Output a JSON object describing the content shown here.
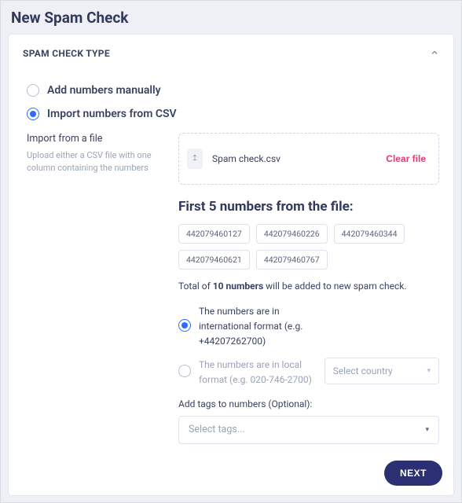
{
  "page": {
    "title": "New Spam Check"
  },
  "section": {
    "title": "SPAM CHECK TYPE"
  },
  "inputMethod": {
    "manual": "Add numbers manually",
    "csv": "Import numbers from CSV"
  },
  "help": {
    "title": "Import from a file",
    "text": "Upload either a CSV file with one column containing the numbers"
  },
  "upload": {
    "fileName": "Spam check.csv",
    "clearLabel": "Clear file"
  },
  "preview": {
    "title": "First 5 numbers from the file:",
    "chips": [
      "442079460127",
      "442079460226",
      "442079460344",
      "442079460621",
      "442079460767"
    ]
  },
  "total": {
    "prefix": "Total of ",
    "count": "10 numbers",
    "suffix": " will be added to new spam check."
  },
  "format": {
    "intl": "The numbers are in international format (e.g. +44207262700)",
    "local": "The numbers are in local format (e.g. 020-746-2700)"
  },
  "country": {
    "placeholder": "Select country"
  },
  "tags": {
    "label": "Add tags to numbers (Optional):",
    "placeholder": "Select tags..."
  },
  "actions": {
    "next": "NEXT"
  }
}
